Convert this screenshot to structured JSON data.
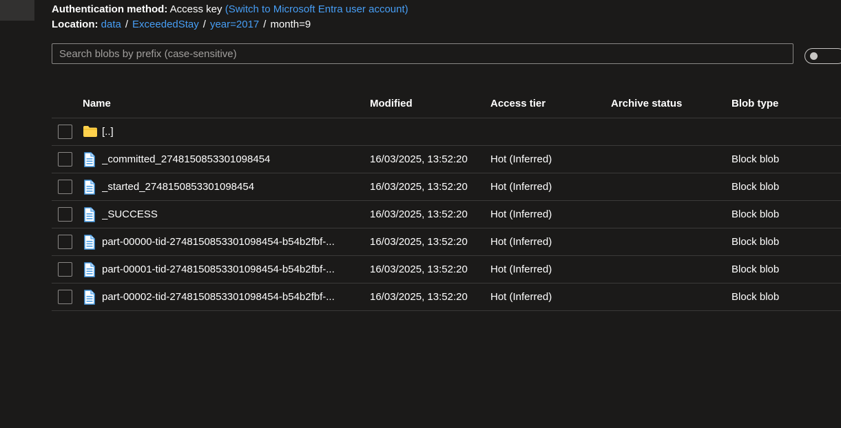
{
  "auth": {
    "label": "Authentication method:",
    "value": "Access key",
    "switch_link": "(Switch to Microsoft Entra user account)"
  },
  "location": {
    "label": "Location:",
    "crumbs": [
      "data",
      "ExceededStay",
      "year=2017"
    ],
    "current": "month=9"
  },
  "search": {
    "placeholder": "Search blobs by prefix (case-sensitive)"
  },
  "table": {
    "columns": {
      "name": "Name",
      "modified": "Modified",
      "access_tier": "Access tier",
      "archive_status": "Archive status",
      "blob_type": "Blob type"
    },
    "parent_row": {
      "name": "[..]",
      "icon": "folder-icon"
    },
    "rows": [
      {
        "name": "_committed_2748150853301098454",
        "modified": "16/03/2025, 13:52:20",
        "access_tier": "Hot (Inferred)",
        "archive_status": "",
        "blob_type": "Block blob",
        "icon": "file-icon"
      },
      {
        "name": "_started_2748150853301098454",
        "modified": "16/03/2025, 13:52:20",
        "access_tier": "Hot (Inferred)",
        "archive_status": "",
        "blob_type": "Block blob",
        "icon": "file-icon"
      },
      {
        "name": "_SUCCESS",
        "modified": "16/03/2025, 13:52:20",
        "access_tier": "Hot (Inferred)",
        "archive_status": "",
        "blob_type": "Block blob",
        "icon": "file-icon"
      },
      {
        "name": "part-00000-tid-2748150853301098454-b54b2fbf-...",
        "modified": "16/03/2025, 13:52:20",
        "access_tier": "Hot (Inferred)",
        "archive_status": "",
        "blob_type": "Block blob",
        "icon": "file-icon"
      },
      {
        "name": "part-00001-tid-2748150853301098454-b54b2fbf-...",
        "modified": "16/03/2025, 13:52:20",
        "access_tier": "Hot (Inferred)",
        "archive_status": "",
        "blob_type": "Block blob",
        "icon": "file-icon"
      },
      {
        "name": "part-00002-tid-2748150853301098454-b54b2fbf-...",
        "modified": "16/03/2025, 13:52:20",
        "access_tier": "Hot (Inferred)",
        "archive_status": "",
        "blob_type": "Block blob",
        "icon": "file-icon"
      }
    ]
  },
  "colors": {
    "background": "#1b1a19",
    "link": "#479ef5",
    "folder": "#ffd24d",
    "file": "#4a9fe8"
  }
}
